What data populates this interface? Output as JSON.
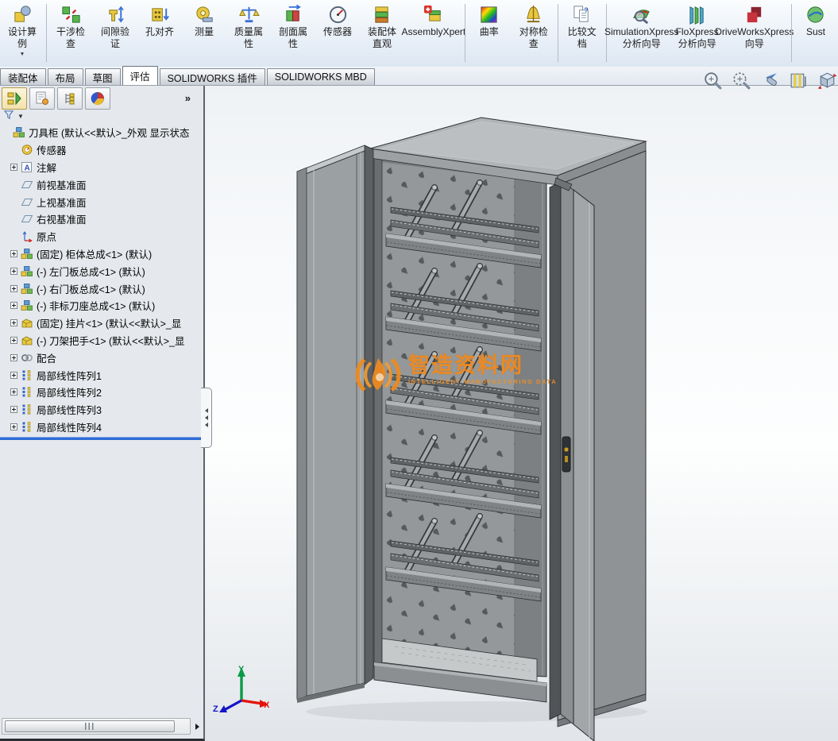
{
  "ribbon": {
    "buttons": [
      {
        "id": "design-study",
        "label": [
          "设计算",
          "例"
        ],
        "dropdown": true
      },
      {
        "id": "interference-check",
        "label": [
          "干涉检",
          "查"
        ],
        "sep_before": true
      },
      {
        "id": "clearance-verify",
        "label": [
          "间隙验",
          "证"
        ]
      },
      {
        "id": "hole-align",
        "label": [
          "孔对齐"
        ]
      },
      {
        "id": "measure",
        "label": [
          "测量"
        ]
      },
      {
        "id": "mass-properties",
        "label": [
          "质量属",
          "性"
        ]
      },
      {
        "id": "section-properties",
        "label": [
          "剖面属",
          "性"
        ]
      },
      {
        "id": "sensor",
        "label": [
          "传感器"
        ]
      },
      {
        "id": "assembly-visualization",
        "label": [
          "装配体",
          "直观"
        ]
      },
      {
        "id": "assembly-xpert",
        "label": [
          "AssemblyXpert"
        ]
      },
      {
        "id": "curvature",
        "label": [
          "曲率"
        ],
        "sep_before": true
      },
      {
        "id": "symmetry-check",
        "label": [
          "对称检",
          "查"
        ]
      },
      {
        "id": "compare-documents",
        "label": [
          "比较文",
          "档"
        ],
        "sep_before": true
      },
      {
        "id": "simulationxpress",
        "label": [
          "SimulationXpress",
          "分析向导"
        ],
        "sep_before": true
      },
      {
        "id": "floxpress",
        "label": [
          "FloXpress",
          "分析向导"
        ]
      },
      {
        "id": "driveworksxpress",
        "label": [
          "DriveWorksXpress",
          "向导"
        ]
      },
      {
        "id": "sustainability",
        "label": [
          "Sust"
        ],
        "sep_before": true
      }
    ]
  },
  "tabs": [
    {
      "label": "装配体",
      "active": false
    },
    {
      "label": "布局",
      "active": false
    },
    {
      "label": "草图",
      "active": false
    },
    {
      "label": "评估",
      "active": true
    },
    {
      "label": "SOLIDWORKS 插件",
      "active": false
    },
    {
      "label": "SOLIDWORKS MBD",
      "active": false
    }
  ],
  "panel": {
    "tabs": [
      {
        "id": "feature-manager-tree",
        "active": true
      },
      {
        "id": "property-manager",
        "active": false
      },
      {
        "id": "configuration-manager",
        "active": false
      },
      {
        "id": "display-manager",
        "active": false
      }
    ],
    "overflow": "»",
    "tree": [
      {
        "icon": "assembly",
        "label": "刀具柜 (默认<<默认>_外观 显示状态",
        "root": true,
        "expand": false
      },
      {
        "icon": "sensor",
        "label": "传感器",
        "expand": false
      },
      {
        "icon": "annotation",
        "label": "注解",
        "expand": true
      },
      {
        "icon": "plane",
        "label": "前视基准面",
        "expand": false
      },
      {
        "icon": "plane",
        "label": "上视基准面",
        "expand": false
      },
      {
        "icon": "plane",
        "label": "右视基准面",
        "expand": false
      },
      {
        "icon": "origin",
        "label": "原点",
        "expand": false
      },
      {
        "icon": "assembly",
        "label": "(固定) 柜体总成<1> (默认)",
        "expand": true
      },
      {
        "icon": "assembly",
        "label": "(-) 左门板总成<1> (默认)",
        "expand": true
      },
      {
        "icon": "assembly",
        "label": "(-) 右门板总成<1> (默认)",
        "expand": true
      },
      {
        "icon": "assembly",
        "label": "(-) 非标刀座总成<1> (默认)",
        "expand": true
      },
      {
        "icon": "part",
        "label": "(固定) 挂片<1> (默认<<默认>_显",
        "expand": true
      },
      {
        "icon": "part",
        "label": "(-) 刀架把手<1> (默认<<默认>_显",
        "expand": true
      },
      {
        "icon": "mates",
        "label": "配合",
        "expand": true
      },
      {
        "icon": "pattern",
        "label": "局部线性阵列1",
        "expand": true
      },
      {
        "icon": "pattern",
        "label": "局部线性阵列2",
        "expand": true
      },
      {
        "icon": "pattern",
        "label": "局部线性阵列3",
        "expand": true
      },
      {
        "icon": "pattern",
        "label": "局部线性阵列4",
        "expand": true
      }
    ]
  },
  "viewport": {
    "headsup": [
      "zoom-fit",
      "zoom-area",
      "previous-view",
      "section-view",
      "view-orientation"
    ],
    "watermark": {
      "title": "智造资料网",
      "subtitle": "INTELLIGENT MANUFACTURING DATA"
    },
    "triad": {
      "x": "X",
      "y": "Y",
      "z": "Z"
    }
  },
  "colors": {
    "watermark_orange": "#f08a1e",
    "rollback_blue": "#2e6bd6",
    "cabinet_gray": "#9a9ea0",
    "panel_bg": "#e5e9ed"
  }
}
